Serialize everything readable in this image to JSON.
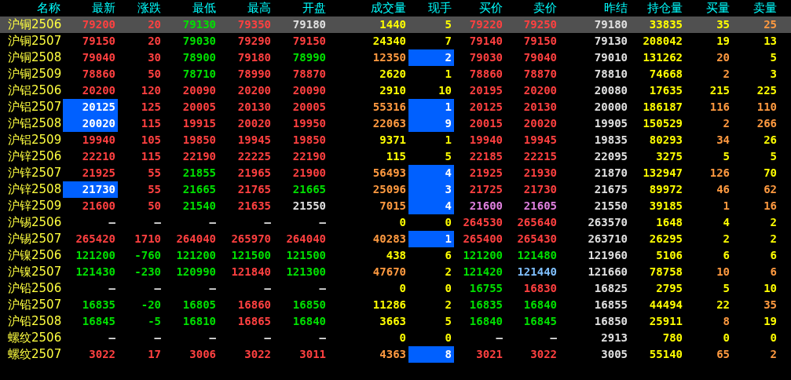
{
  "columns": [
    "名称",
    "最新",
    "涨跌",
    "最低",
    "最高",
    "开盘",
    "成交量",
    "现手",
    "买价",
    "卖价",
    "昨结",
    "持仓量",
    "买量",
    "卖量"
  ],
  "rows": [
    {
      "name": "沪铜2506",
      "selected": true,
      "cells": [
        {
          "text": "79200",
          "color": "#ff4040",
          "highlighted": false
        },
        {
          "text": "20",
          "color": "#ff4040"
        },
        {
          "text": "79130",
          "color": "#00e000"
        },
        {
          "text": "79350",
          "color": "#ff4040"
        },
        {
          "text": "79180",
          "color": "#e0e0e0"
        },
        {
          "text": "1440",
          "color": "#ffff00"
        },
        {
          "text": "5",
          "color": "#ffff00",
          "highlighted": false
        },
        {
          "text": "79220",
          "color": "#ff4040"
        },
        {
          "text": "79250",
          "color": "#ff4040"
        },
        {
          "text": "79180",
          "color": "#e0e0e0"
        },
        {
          "text": "33835",
          "color": "#ffff00"
        },
        {
          "text": "35",
          "color": "#ffff00"
        },
        {
          "text": "25",
          "color": "#ff9a40"
        }
      ]
    },
    {
      "name": "沪铜2507",
      "selected": false,
      "cells": [
        {
          "text": "79150",
          "color": "#ff4040",
          "highlighted": false
        },
        {
          "text": "20",
          "color": "#ff4040"
        },
        {
          "text": "79030",
          "color": "#00e000"
        },
        {
          "text": "79290",
          "color": "#ff4040"
        },
        {
          "text": "79150",
          "color": "#ff4040"
        },
        {
          "text": "24340",
          "color": "#ffff00"
        },
        {
          "text": "7",
          "color": "#ffff00",
          "highlighted": false
        },
        {
          "text": "79140",
          "color": "#ff4040"
        },
        {
          "text": "79150",
          "color": "#ff4040"
        },
        {
          "text": "79130",
          "color": "#e0e0e0"
        },
        {
          "text": "208042",
          "color": "#ffff00"
        },
        {
          "text": "19",
          "color": "#ffff00"
        },
        {
          "text": "13",
          "color": "#ffff00"
        }
      ]
    },
    {
      "name": "沪铜2508",
      "selected": false,
      "cells": [
        {
          "text": "79040",
          "color": "#ff4040",
          "highlighted": false
        },
        {
          "text": "30",
          "color": "#ff4040"
        },
        {
          "text": "78900",
          "color": "#00e000"
        },
        {
          "text": "79180",
          "color": "#ff4040"
        },
        {
          "text": "78990",
          "color": "#00e000"
        },
        {
          "text": "12350",
          "color": "#ff9a40"
        },
        {
          "text": "2",
          "color": "#ffffff",
          "highlighted": true
        },
        {
          "text": "79030",
          "color": "#ff4040"
        },
        {
          "text": "79040",
          "color": "#ff4040"
        },
        {
          "text": "79010",
          "color": "#e0e0e0"
        },
        {
          "text": "131262",
          "color": "#ffff00"
        },
        {
          "text": "20",
          "color": "#ff9a40"
        },
        {
          "text": "5",
          "color": "#ffff00"
        }
      ]
    },
    {
      "name": "沪铜2509",
      "selected": false,
      "cells": [
        {
          "text": "78860",
          "color": "#ff4040",
          "highlighted": false
        },
        {
          "text": "50",
          "color": "#ff4040"
        },
        {
          "text": "78710",
          "color": "#00e000"
        },
        {
          "text": "78990",
          "color": "#ff4040"
        },
        {
          "text": "78870",
          "color": "#ff4040"
        },
        {
          "text": "2620",
          "color": "#ffff00"
        },
        {
          "text": "1",
          "color": "#ffff00",
          "highlighted": false
        },
        {
          "text": "78860",
          "color": "#ff4040"
        },
        {
          "text": "78870",
          "color": "#ff4040"
        },
        {
          "text": "78810",
          "color": "#e0e0e0"
        },
        {
          "text": "74668",
          "color": "#ffff00"
        },
        {
          "text": "2",
          "color": "#ff9a40"
        },
        {
          "text": "3",
          "color": "#ffff00"
        }
      ]
    },
    {
      "name": "沪铝2506",
      "selected": false,
      "cells": [
        {
          "text": "20200",
          "color": "#ff4040",
          "highlighted": false
        },
        {
          "text": "120",
          "color": "#ff4040"
        },
        {
          "text": "20090",
          "color": "#ff4040"
        },
        {
          "text": "20200",
          "color": "#ff4040"
        },
        {
          "text": "20090",
          "color": "#ff4040"
        },
        {
          "text": "2910",
          "color": "#ffff00"
        },
        {
          "text": "10",
          "color": "#ffff00",
          "highlighted": false
        },
        {
          "text": "20195",
          "color": "#ff4040"
        },
        {
          "text": "20200",
          "color": "#ff4040"
        },
        {
          "text": "20080",
          "color": "#e0e0e0"
        },
        {
          "text": "17635",
          "color": "#ffff00"
        },
        {
          "text": "215",
          "color": "#ffff00"
        },
        {
          "text": "225",
          "color": "#ffff00"
        }
      ]
    },
    {
      "name": "沪铝2507",
      "selected": false,
      "cells": [
        {
          "text": "20125",
          "color": "#ffffff",
          "highlighted": true
        },
        {
          "text": "125",
          "color": "#ff4040"
        },
        {
          "text": "20005",
          "color": "#ff4040"
        },
        {
          "text": "20130",
          "color": "#ff4040"
        },
        {
          "text": "20005",
          "color": "#ff4040"
        },
        {
          "text": "55316",
          "color": "#ff9a40"
        },
        {
          "text": "1",
          "color": "#ffffff",
          "highlighted": true
        },
        {
          "text": "20125",
          "color": "#ff4040"
        },
        {
          "text": "20130",
          "color": "#ff4040"
        },
        {
          "text": "20000",
          "color": "#e0e0e0"
        },
        {
          "text": "186187",
          "color": "#ffff00"
        },
        {
          "text": "116",
          "color": "#ff9a40"
        },
        {
          "text": "110",
          "color": "#ff9a40"
        }
      ]
    },
    {
      "name": "沪铝2508",
      "selected": false,
      "cells": [
        {
          "text": "20020",
          "color": "#ffffff",
          "highlighted": true
        },
        {
          "text": "115",
          "color": "#ff4040"
        },
        {
          "text": "19915",
          "color": "#ff4040"
        },
        {
          "text": "20020",
          "color": "#ff4040"
        },
        {
          "text": "19950",
          "color": "#ff4040"
        },
        {
          "text": "22063",
          "color": "#ff9a40"
        },
        {
          "text": "9",
          "color": "#ffffff",
          "highlighted": true
        },
        {
          "text": "20015",
          "color": "#ff4040"
        },
        {
          "text": "20020",
          "color": "#ff4040"
        },
        {
          "text": "19905",
          "color": "#e0e0e0"
        },
        {
          "text": "150529",
          "color": "#ffff00"
        },
        {
          "text": "2",
          "color": "#ff9a40"
        },
        {
          "text": "266",
          "color": "#ff9a40"
        }
      ]
    },
    {
      "name": "沪铝2509",
      "selected": false,
      "cells": [
        {
          "text": "19940",
          "color": "#ff4040",
          "highlighted": false
        },
        {
          "text": "105",
          "color": "#ff4040"
        },
        {
          "text": "19850",
          "color": "#ff4040"
        },
        {
          "text": "19945",
          "color": "#ff4040"
        },
        {
          "text": "19850",
          "color": "#ff4040"
        },
        {
          "text": "9371",
          "color": "#ffff00"
        },
        {
          "text": "1",
          "color": "#ffff00",
          "highlighted": false
        },
        {
          "text": "19940",
          "color": "#ff4040"
        },
        {
          "text": "19945",
          "color": "#ff4040"
        },
        {
          "text": "19835",
          "color": "#e0e0e0"
        },
        {
          "text": "80293",
          "color": "#ffff00"
        },
        {
          "text": "34",
          "color": "#ff9a40"
        },
        {
          "text": "26",
          "color": "#ffff00"
        }
      ]
    },
    {
      "name": "沪锌2506",
      "selected": false,
      "cells": [
        {
          "text": "22210",
          "color": "#ff4040",
          "highlighted": false
        },
        {
          "text": "115",
          "color": "#ff4040"
        },
        {
          "text": "22190",
          "color": "#ff4040"
        },
        {
          "text": "22225",
          "color": "#ff4040"
        },
        {
          "text": "22190",
          "color": "#ff4040"
        },
        {
          "text": "115",
          "color": "#ffff00"
        },
        {
          "text": "5",
          "color": "#ffff00",
          "highlighted": false
        },
        {
          "text": "22185",
          "color": "#ff4040"
        },
        {
          "text": "22215",
          "color": "#ff4040"
        },
        {
          "text": "22095",
          "color": "#e0e0e0"
        },
        {
          "text": "3275",
          "color": "#ffff00"
        },
        {
          "text": "5",
          "color": "#ffff00"
        },
        {
          "text": "5",
          "color": "#ffff00"
        }
      ]
    },
    {
      "name": "沪锌2507",
      "selected": false,
      "cells": [
        {
          "text": "21925",
          "color": "#ff4040",
          "highlighted": false
        },
        {
          "text": "55",
          "color": "#ff4040"
        },
        {
          "text": "21855",
          "color": "#00e000"
        },
        {
          "text": "21965",
          "color": "#ff4040"
        },
        {
          "text": "21900",
          "color": "#ff4040"
        },
        {
          "text": "56493",
          "color": "#ff9a40"
        },
        {
          "text": "4",
          "color": "#ffffff",
          "highlighted": true
        },
        {
          "text": "21925",
          "color": "#ff4040"
        },
        {
          "text": "21930",
          "color": "#ff4040"
        },
        {
          "text": "21870",
          "color": "#e0e0e0"
        },
        {
          "text": "132947",
          "color": "#ffff00"
        },
        {
          "text": "126",
          "color": "#ff9a40"
        },
        {
          "text": "70",
          "color": "#ffff00"
        }
      ]
    },
    {
      "name": "沪锌2508",
      "selected": false,
      "cells": [
        {
          "text": "21730",
          "color": "#ffffff",
          "highlighted": true
        },
        {
          "text": "55",
          "color": "#ff4040"
        },
        {
          "text": "21665",
          "color": "#00e000"
        },
        {
          "text": "21765",
          "color": "#ff4040"
        },
        {
          "text": "21665",
          "color": "#00e000"
        },
        {
          "text": "25096",
          "color": "#ff9a40"
        },
        {
          "text": "3",
          "color": "#ffffff",
          "highlighted": true
        },
        {
          "text": "21725",
          "color": "#ff4040"
        },
        {
          "text": "21730",
          "color": "#ff4040"
        },
        {
          "text": "21675",
          "color": "#e0e0e0"
        },
        {
          "text": "89972",
          "color": "#ffff00"
        },
        {
          "text": "46",
          "color": "#ff9a40"
        },
        {
          "text": "62",
          "color": "#ff9a40"
        }
      ]
    },
    {
      "name": "沪锌2509",
      "selected": false,
      "cells": [
        {
          "text": "21600",
          "color": "#ff4040",
          "highlighted": false
        },
        {
          "text": "50",
          "color": "#ff4040"
        },
        {
          "text": "21540",
          "color": "#00e000"
        },
        {
          "text": "21635",
          "color": "#ff4040"
        },
        {
          "text": "21550",
          "color": "#e0e0e0"
        },
        {
          "text": "7015",
          "color": "#ff9a40"
        },
        {
          "text": "4",
          "color": "#ffffff",
          "highlighted": true
        },
        {
          "text": "21600",
          "color": "#e080e0"
        },
        {
          "text": "21605",
          "color": "#e080e0"
        },
        {
          "text": "21550",
          "color": "#e0e0e0"
        },
        {
          "text": "39185",
          "color": "#ffff00"
        },
        {
          "text": "1",
          "color": "#ff9a40"
        },
        {
          "text": "16",
          "color": "#ff9a40"
        }
      ]
    },
    {
      "name": "沪锡2506",
      "selected": false,
      "cells": [
        {
          "text": "—",
          "color": "#e0e0e0",
          "highlighted": false
        },
        {
          "text": "—",
          "color": "#e0e0e0"
        },
        {
          "text": "—",
          "color": "#e0e0e0"
        },
        {
          "text": "—",
          "color": "#e0e0e0"
        },
        {
          "text": "—",
          "color": "#e0e0e0"
        },
        {
          "text": "0",
          "color": "#ffff00"
        },
        {
          "text": "0",
          "color": "#ffff00",
          "highlighted": false
        },
        {
          "text": "264530",
          "color": "#ff4040"
        },
        {
          "text": "265640",
          "color": "#ff4040"
        },
        {
          "text": "263570",
          "color": "#e0e0e0"
        },
        {
          "text": "1648",
          "color": "#ffff00"
        },
        {
          "text": "4",
          "color": "#ffff00"
        },
        {
          "text": "2",
          "color": "#ffff00"
        }
      ]
    },
    {
      "name": "沪锡2507",
      "selected": false,
      "cells": [
        {
          "text": "265420",
          "color": "#ff4040",
          "highlighted": false
        },
        {
          "text": "1710",
          "color": "#ff4040"
        },
        {
          "text": "264040",
          "color": "#ff4040"
        },
        {
          "text": "265970",
          "color": "#ff4040"
        },
        {
          "text": "264040",
          "color": "#ff4040"
        },
        {
          "text": "40283",
          "color": "#ff9a40"
        },
        {
          "text": "1",
          "color": "#ffffff",
          "highlighted": true
        },
        {
          "text": "265400",
          "color": "#ff4040"
        },
        {
          "text": "265430",
          "color": "#ff4040"
        },
        {
          "text": "263710",
          "color": "#e0e0e0"
        },
        {
          "text": "26295",
          "color": "#ffff00"
        },
        {
          "text": "2",
          "color": "#ffff00"
        },
        {
          "text": "2",
          "color": "#ffff00"
        }
      ]
    },
    {
      "name": "沪镍2506",
      "selected": false,
      "cells": [
        {
          "text": "121200",
          "color": "#00e000",
          "highlighted": false
        },
        {
          "text": "-760",
          "color": "#00e000"
        },
        {
          "text": "121200",
          "color": "#00e000"
        },
        {
          "text": "121500",
          "color": "#00e000"
        },
        {
          "text": "121500",
          "color": "#00e000"
        },
        {
          "text": "438",
          "color": "#ffff00"
        },
        {
          "text": "6",
          "color": "#ffff00",
          "highlighted": false
        },
        {
          "text": "121200",
          "color": "#00e000"
        },
        {
          "text": "121480",
          "color": "#00e000"
        },
        {
          "text": "121960",
          "color": "#e0e0e0"
        },
        {
          "text": "5106",
          "color": "#ffff00"
        },
        {
          "text": "6",
          "color": "#ffff00"
        },
        {
          "text": "6",
          "color": "#ffff00"
        }
      ]
    },
    {
      "name": "沪镍2507",
      "selected": false,
      "cells": [
        {
          "text": "121430",
          "color": "#00e000",
          "highlighted": false
        },
        {
          "text": "-230",
          "color": "#00e000"
        },
        {
          "text": "120990",
          "color": "#00e000"
        },
        {
          "text": "121840",
          "color": "#ff4040"
        },
        {
          "text": "121300",
          "color": "#00e000"
        },
        {
          "text": "47670",
          "color": "#ff9a40"
        },
        {
          "text": "2",
          "color": "#ffff00",
          "highlighted": false
        },
        {
          "text": "121420",
          "color": "#00e000"
        },
        {
          "text": "121440",
          "color": "#80c0ff"
        },
        {
          "text": "121660",
          "color": "#e0e0e0"
        },
        {
          "text": "78758",
          "color": "#ffff00"
        },
        {
          "text": "10",
          "color": "#ff9a40"
        },
        {
          "text": "6",
          "color": "#ff9a40"
        }
      ]
    },
    {
      "name": "沪铅2506",
      "selected": false,
      "cells": [
        {
          "text": "—",
          "color": "#e0e0e0",
          "highlighted": false
        },
        {
          "text": "—",
          "color": "#e0e0e0"
        },
        {
          "text": "—",
          "color": "#e0e0e0"
        },
        {
          "text": "—",
          "color": "#e0e0e0"
        },
        {
          "text": "—",
          "color": "#e0e0e0"
        },
        {
          "text": "0",
          "color": "#ffff00"
        },
        {
          "text": "0",
          "color": "#ffff00",
          "highlighted": false
        },
        {
          "text": "16755",
          "color": "#00e000"
        },
        {
          "text": "16830",
          "color": "#ff4040"
        },
        {
          "text": "16825",
          "color": "#e0e0e0"
        },
        {
          "text": "2795",
          "color": "#ffff00"
        },
        {
          "text": "5",
          "color": "#ffff00"
        },
        {
          "text": "10",
          "color": "#ffff00"
        }
      ]
    },
    {
      "name": "沪铅2507",
      "selected": false,
      "cells": [
        {
          "text": "16835",
          "color": "#00e000",
          "highlighted": false
        },
        {
          "text": "-20",
          "color": "#00e000"
        },
        {
          "text": "16805",
          "color": "#00e000"
        },
        {
          "text": "16860",
          "color": "#ff4040"
        },
        {
          "text": "16850",
          "color": "#00e000"
        },
        {
          "text": "11286",
          "color": "#ffff00"
        },
        {
          "text": "2",
          "color": "#ffff00",
          "highlighted": false
        },
        {
          "text": "16835",
          "color": "#00e000"
        },
        {
          "text": "16840",
          "color": "#00e000"
        },
        {
          "text": "16855",
          "color": "#e0e0e0"
        },
        {
          "text": "44494",
          "color": "#ffff00"
        },
        {
          "text": "22",
          "color": "#ffff00"
        },
        {
          "text": "35",
          "color": "#ff9a40"
        }
      ]
    },
    {
      "name": "沪铅2508",
      "selected": false,
      "cells": [
        {
          "text": "16845",
          "color": "#00e000",
          "highlighted": false
        },
        {
          "text": "-5",
          "color": "#00e000"
        },
        {
          "text": "16810",
          "color": "#00e000"
        },
        {
          "text": "16865",
          "color": "#ff4040"
        },
        {
          "text": "16840",
          "color": "#00e000"
        },
        {
          "text": "3663",
          "color": "#ffff00"
        },
        {
          "text": "5",
          "color": "#ffff00",
          "highlighted": false
        },
        {
          "text": "16840",
          "color": "#00e000"
        },
        {
          "text": "16845",
          "color": "#00e000"
        },
        {
          "text": "16850",
          "color": "#e0e0e0"
        },
        {
          "text": "25911",
          "color": "#ffff00"
        },
        {
          "text": "8",
          "color": "#ff9a40"
        },
        {
          "text": "19",
          "color": "#ffff00"
        }
      ]
    },
    {
      "name": "螺纹2506",
      "selected": false,
      "cells": [
        {
          "text": "—",
          "color": "#e0e0e0",
          "highlighted": false
        },
        {
          "text": "—",
          "color": "#e0e0e0"
        },
        {
          "text": "—",
          "color": "#e0e0e0"
        },
        {
          "text": "—",
          "color": "#e0e0e0"
        },
        {
          "text": "—",
          "color": "#e0e0e0"
        },
        {
          "text": "0",
          "color": "#ffff00"
        },
        {
          "text": "0",
          "color": "#ffff00",
          "highlighted": false
        },
        {
          "text": "—",
          "color": "#e0e0e0"
        },
        {
          "text": "—",
          "color": "#e0e0e0"
        },
        {
          "text": "2913",
          "color": "#e0e0e0"
        },
        {
          "text": "780",
          "color": "#ffff00"
        },
        {
          "text": "0",
          "color": "#ffff00"
        },
        {
          "text": "0",
          "color": "#ffff00"
        }
      ]
    },
    {
      "name": "螺纹2507",
      "selected": false,
      "cells": [
        {
          "text": "3022",
          "color": "#ff4040",
          "highlighted": false
        },
        {
          "text": "17",
          "color": "#ff4040"
        },
        {
          "text": "3006",
          "color": "#ff4040"
        },
        {
          "text": "3022",
          "color": "#ff4040"
        },
        {
          "text": "3011",
          "color": "#ff4040"
        },
        {
          "text": "4363",
          "color": "#ff9a40"
        },
        {
          "text": "8",
          "color": "#ffffff",
          "highlighted": true
        },
        {
          "text": "3021",
          "color": "#ff4040"
        },
        {
          "text": "3022",
          "color": "#ff4040"
        },
        {
          "text": "3005",
          "color": "#e0e0e0"
        },
        {
          "text": "55140",
          "color": "#ffff00"
        },
        {
          "text": "65",
          "color": "#ff9a40"
        },
        {
          "text": "2",
          "color": "#ff9a40"
        }
      ]
    }
  ]
}
